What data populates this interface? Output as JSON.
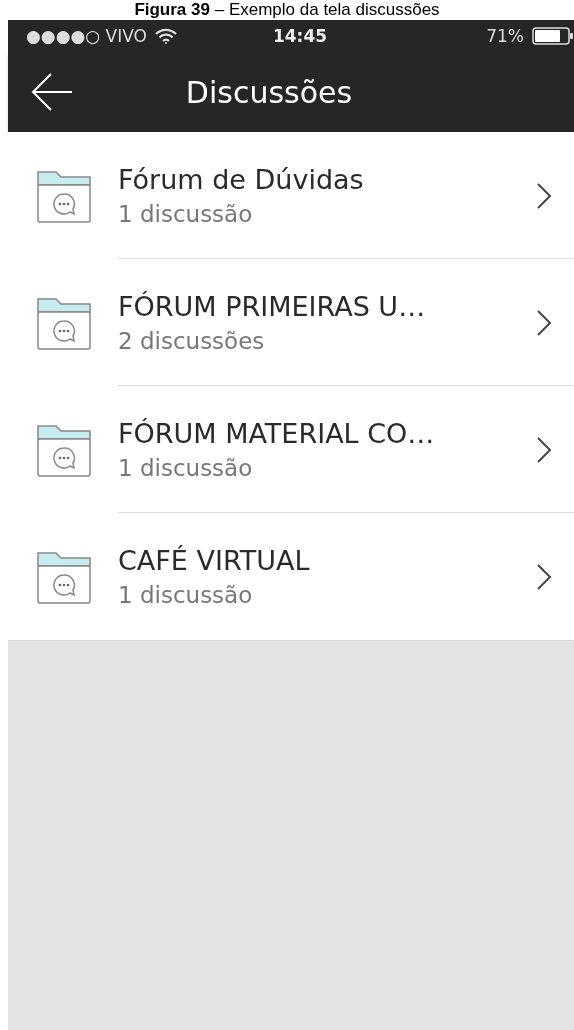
{
  "caption": {
    "label": "Figura 39",
    "text": "– Exemplo da tela discussões"
  },
  "status_bar": {
    "carrier": "●●●●○ VIVO",
    "time": "14:45",
    "battery": "71%"
  },
  "nav_bar": {
    "title": "Discussões"
  },
  "forums": [
    {
      "title": "Fórum de Dúvidas",
      "count": "1 discussão"
    },
    {
      "title": "FÓRUM PRIMEIRAS U…",
      "count": "2 discussões"
    },
    {
      "title": "FÓRUM MATERIAL CO…",
      "count": "1 discussão"
    },
    {
      "title": "CAFÉ VIRTUAL",
      "count": "1 discussão"
    }
  ]
}
